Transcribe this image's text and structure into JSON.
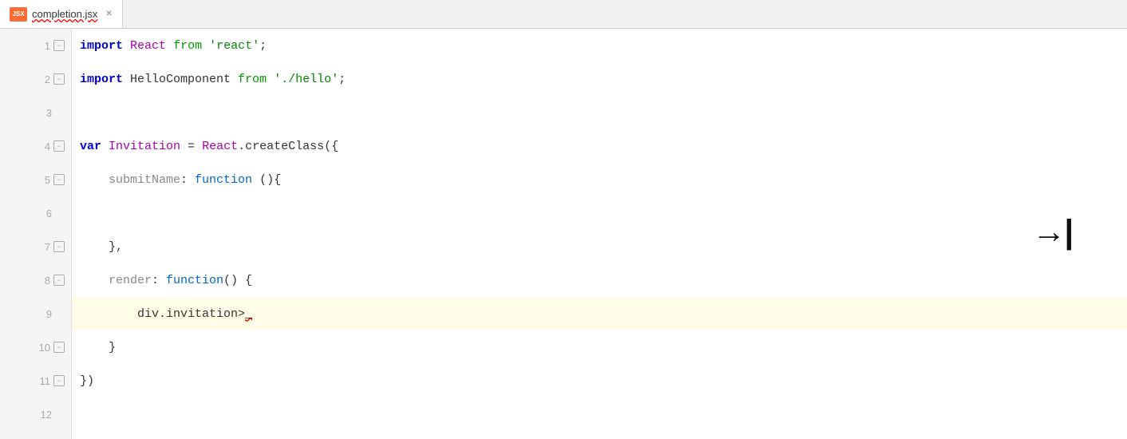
{
  "tab": {
    "icon_label": "JSX",
    "file_name": "completion.jsx",
    "close_symbol": "×"
  },
  "arrow": {
    "symbol": "→|"
  },
  "lines": [
    {
      "number": "1",
      "fold": "open",
      "tokens": [
        {
          "type": "kw-import",
          "text": "import"
        },
        {
          "type": "plain",
          "text": " "
        },
        {
          "type": "cls",
          "text": "React"
        },
        {
          "type": "plain",
          "text": " "
        },
        {
          "type": "kw-from",
          "text": "from"
        },
        {
          "type": "plain",
          "text": " "
        },
        {
          "type": "str",
          "text": "'react'"
        },
        {
          "type": "plain",
          "text": ";"
        }
      ],
      "highlighted": false
    },
    {
      "number": "2",
      "fold": "open",
      "tokens": [
        {
          "type": "kw-import",
          "text": "import"
        },
        {
          "type": "plain",
          "text": " HelloComponent "
        },
        {
          "type": "kw-from",
          "text": "from"
        },
        {
          "type": "plain",
          "text": " "
        },
        {
          "type": "str",
          "text": "'./hello'"
        },
        {
          "type": "plain",
          "text": ";"
        }
      ],
      "highlighted": false
    },
    {
      "number": "3",
      "fold": "none",
      "tokens": [],
      "highlighted": false
    },
    {
      "number": "4",
      "fold": "open",
      "tokens": [
        {
          "type": "kw-var",
          "text": "var"
        },
        {
          "type": "plain",
          "text": " "
        },
        {
          "type": "cls",
          "text": "Invitation"
        },
        {
          "type": "plain",
          "text": " = "
        },
        {
          "type": "cls",
          "text": "React"
        },
        {
          "type": "plain",
          "text": ".createClass({"
        }
      ],
      "highlighted": false
    },
    {
      "number": "5",
      "fold": "open",
      "tokens": [
        {
          "type": "prop",
          "text": "    submitName"
        },
        {
          "type": "plain",
          "text": ": "
        },
        {
          "type": "kw-function",
          "text": "function"
        },
        {
          "type": "plain",
          "text": " (){"
        }
      ],
      "highlighted": false
    },
    {
      "number": "6",
      "fold": "none",
      "tokens": [],
      "highlighted": false
    },
    {
      "number": "7",
      "fold": "open",
      "tokens": [
        {
          "type": "plain",
          "text": "    },"
        }
      ],
      "highlighted": false
    },
    {
      "number": "8",
      "fold": "open",
      "tokens": [
        {
          "type": "prop",
          "text": "    render"
        },
        {
          "type": "plain",
          "text": ": "
        },
        {
          "type": "kw-function",
          "text": "function"
        },
        {
          "type": "plain",
          "text": "() {"
        }
      ],
      "highlighted": false
    },
    {
      "number": "9",
      "fold": "none",
      "tokens": [
        {
          "type": "plain",
          "text": "        div.invitation>"
        },
        {
          "type": "squiggly",
          "text": ""
        }
      ],
      "highlighted": true
    },
    {
      "number": "10",
      "fold": "open",
      "tokens": [
        {
          "type": "plain",
          "text": "    }"
        }
      ],
      "highlighted": false
    },
    {
      "number": "11",
      "fold": "open",
      "tokens": [
        {
          "type": "plain",
          "text": "})"
        }
      ],
      "highlighted": false
    },
    {
      "number": "12",
      "fold": "none",
      "tokens": [],
      "highlighted": false
    }
  ]
}
